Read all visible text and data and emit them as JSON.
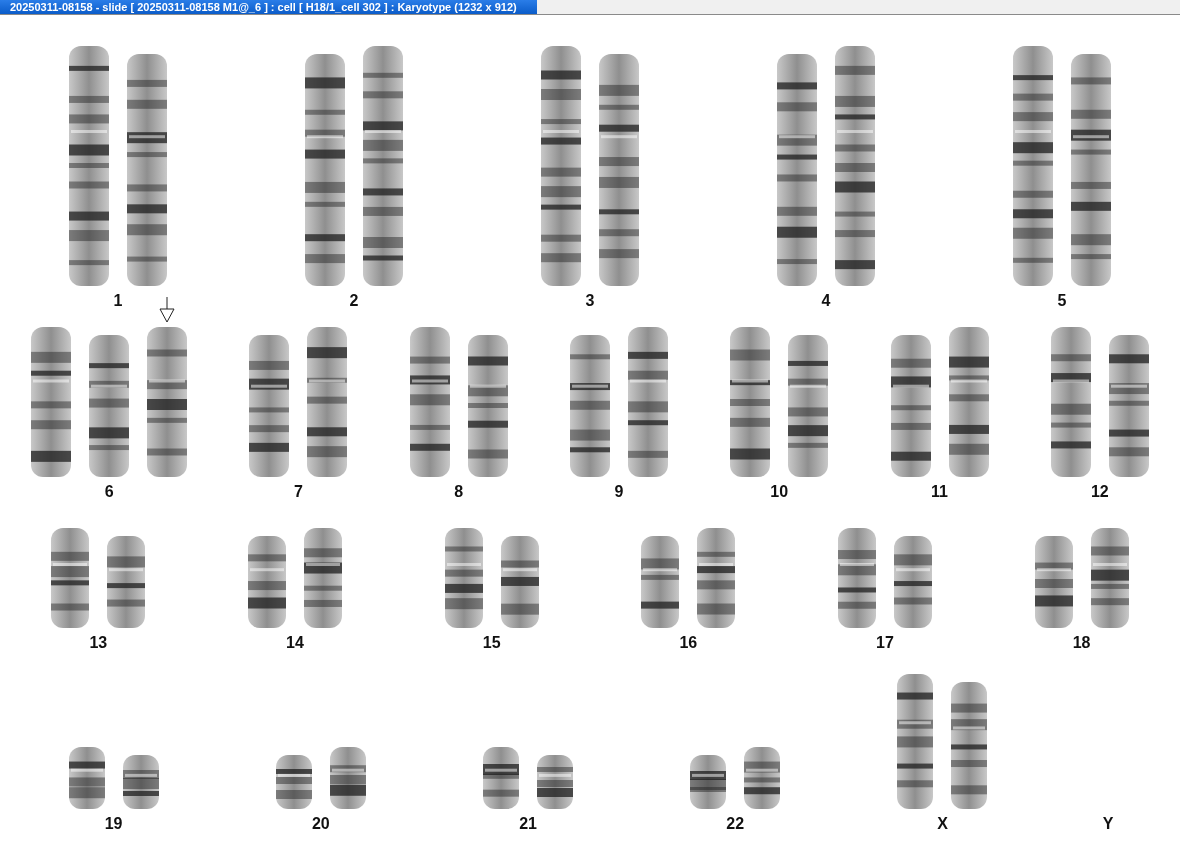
{
  "window": {
    "title": "20250311-08158 - slide [ 20250311-08158 M1@_6 ] : cell [ H18/1_cell 302 ] : Karyotype  (1232 x 912)"
  },
  "karyotype": {
    "rows": [
      {
        "groups": [
          {
            "label": "1",
            "kind": "large",
            "chromosomes": [
              {
                "marked": false
              },
              {
                "marked": false
              }
            ]
          },
          {
            "label": "2",
            "kind": "large",
            "chromosomes": [
              {
                "marked": false
              },
              {
                "marked": false
              }
            ]
          },
          {
            "label": "3",
            "kind": "large",
            "chromosomes": [
              {
                "marked": false
              },
              {
                "marked": false
              }
            ]
          },
          {
            "label": "4",
            "kind": "large",
            "chromosomes": [
              {
                "marked": false
              },
              {
                "marked": false
              }
            ]
          },
          {
            "label": "5",
            "kind": "large",
            "chromosomes": [
              {
                "marked": false
              },
              {
                "marked": false
              }
            ]
          }
        ]
      },
      {
        "groups": [
          {
            "label": "6",
            "kind": "medium",
            "chromosomes": [
              {
                "marked": false
              },
              {
                "marked": false
              },
              {
                "marked": true
              }
            ]
          },
          {
            "label": "7",
            "kind": "medium",
            "chromosomes": [
              {
                "marked": false
              },
              {
                "marked": false
              }
            ]
          },
          {
            "label": "8",
            "kind": "medium",
            "chromosomes": [
              {
                "marked": false
              },
              {
                "marked": false
              }
            ]
          },
          {
            "label": "9",
            "kind": "medium",
            "chromosomes": [
              {
                "marked": false
              },
              {
                "marked": false
              }
            ]
          },
          {
            "label": "10",
            "kind": "medium",
            "chromosomes": [
              {
                "marked": false
              },
              {
                "marked": false
              }
            ]
          },
          {
            "label": "11",
            "kind": "medium",
            "chromosomes": [
              {
                "marked": false
              },
              {
                "marked": false
              }
            ]
          },
          {
            "label": "12",
            "kind": "medium",
            "chromosomes": [
              {
                "marked": false
              },
              {
                "marked": false
              }
            ]
          }
        ]
      },
      {
        "groups": [
          {
            "label": "13",
            "kind": "short",
            "chromosomes": [
              {
                "marked": false
              },
              {
                "marked": false
              }
            ]
          },
          {
            "label": "14",
            "kind": "short",
            "chromosomes": [
              {
                "marked": false
              },
              {
                "marked": false
              }
            ]
          },
          {
            "label": "15",
            "kind": "short",
            "chromosomes": [
              {
                "marked": false
              },
              {
                "marked": false
              }
            ]
          },
          {
            "label": "16",
            "kind": "short",
            "chromosomes": [
              {
                "marked": false
              },
              {
                "marked": false
              }
            ]
          },
          {
            "label": "17",
            "kind": "short",
            "chromosomes": [
              {
                "marked": false
              },
              {
                "marked": false
              }
            ]
          },
          {
            "label": "18",
            "kind": "short",
            "chromosomes": [
              {
                "marked": false
              },
              {
                "marked": false
              }
            ]
          }
        ]
      },
      {
        "groups": [
          {
            "label": "19",
            "kind": "tiny",
            "chromosomes": [
              {
                "marked": false
              },
              {
                "marked": false
              }
            ]
          },
          {
            "label": "20",
            "kind": "tiny",
            "chromosomes": [
              {
                "marked": false
              },
              {
                "marked": false
              }
            ]
          },
          {
            "label": "21",
            "kind": "tiny",
            "chromosomes": [
              {
                "marked": false
              },
              {
                "marked": false
              }
            ]
          },
          {
            "label": "22",
            "kind": "tiny",
            "chromosomes": [
              {
                "marked": false
              },
              {
                "marked": false
              }
            ]
          },
          {
            "label": "X",
            "kind": "sex",
            "chromosomes": [
              {
                "marked": false
              },
              {
                "marked": false
              }
            ]
          },
          {
            "label": "Y",
            "kind": "sex"
          }
        ]
      }
    ]
  }
}
